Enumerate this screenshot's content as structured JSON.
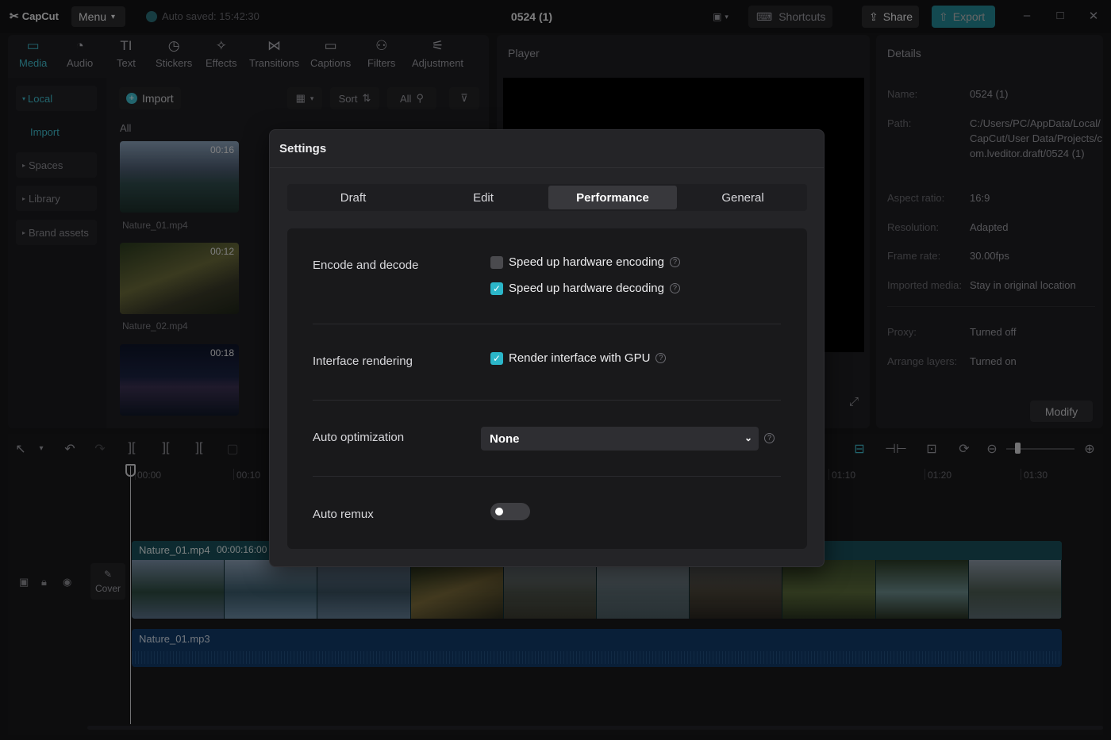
{
  "app": {
    "logo": "CapCut",
    "menu_label": "Menu",
    "autosave": "Auto saved: 15:42:30",
    "project_title": "0524 (1)",
    "shortcuts_label": "Shortcuts",
    "share_label": "Share",
    "export_label": "Export",
    "accent_color": "#2bb6c9"
  },
  "toolbar": {
    "items": [
      {
        "label": "Media",
        "icon": "media-icon"
      },
      {
        "label": "Audio",
        "icon": "audio-icon"
      },
      {
        "label": "Text",
        "icon": "text-icon"
      },
      {
        "label": "Stickers",
        "icon": "stickers-icon"
      },
      {
        "label": "Effects",
        "icon": "effects-icon"
      },
      {
        "label": "Transitions",
        "icon": "transitions-icon"
      },
      {
        "label": "Captions",
        "icon": "captions-icon"
      },
      {
        "label": "Filters",
        "icon": "filters-icon"
      },
      {
        "label": "Adjustment",
        "icon": "adjustment-icon"
      }
    ]
  },
  "sidebar": {
    "items": [
      {
        "label": "Local"
      },
      {
        "label": "Import"
      },
      {
        "label": "Spaces"
      },
      {
        "label": "Library"
      },
      {
        "label": "Brand assets"
      }
    ]
  },
  "media": {
    "import_label": "Import",
    "sort_label": "Sort",
    "all_filter_label": "All",
    "section_label": "All",
    "clips": [
      {
        "name": "Nature_01.mp4",
        "duration": "00:16"
      },
      {
        "name": "Nature_02.mp4",
        "duration": "00:12"
      },
      {
        "name": "",
        "duration": "00:18"
      }
    ]
  },
  "player": {
    "title": "Player"
  },
  "details": {
    "title": "Details",
    "rows": [
      {
        "label": "Name:",
        "value": "0524 (1)"
      },
      {
        "label": "Path:",
        "value": "C:/Users/PC/AppData/Local/CapCut/User Data/Projects/com.lveditor.draft/0524 (1)"
      },
      {
        "label": "Aspect ratio:",
        "value": "16:9"
      },
      {
        "label": "Resolution:",
        "value": "Adapted"
      },
      {
        "label": "Frame rate:",
        "value": "30.00fps"
      },
      {
        "label": "Imported media:",
        "value": "Stay in original location"
      },
      {
        "label": "Proxy:",
        "value": "Turned off"
      },
      {
        "label": "Arrange layers:",
        "value": "Turned on"
      }
    ],
    "modify_label": "Modify"
  },
  "timeline": {
    "ruler": [
      "00:00",
      "00:10",
      "01:10",
      "01:20",
      "01:30"
    ],
    "video_track": {
      "name": "Nature_01.mp4",
      "duration": "00:00:16:00"
    },
    "audio_track": {
      "name": "Nature_01.mp3"
    },
    "cover_label": "Cover"
  },
  "settings": {
    "title": "Settings",
    "tabs": [
      "Draft",
      "Edit",
      "Performance",
      "General"
    ],
    "active_tab": "Performance",
    "sections": {
      "encode": {
        "label": "Encode and decode",
        "hw_encoding": {
          "label": "Speed up hardware encoding",
          "checked": false
        },
        "hw_decoding": {
          "label": "Speed up hardware decoding",
          "checked": true
        }
      },
      "rendering": {
        "label": "Interface rendering",
        "gpu": {
          "label": "Render interface with GPU",
          "checked": true
        }
      },
      "auto_optimization": {
        "label": "Auto optimization",
        "value": "None"
      },
      "auto_remux": {
        "label": "Auto remux",
        "on": false
      }
    }
  }
}
